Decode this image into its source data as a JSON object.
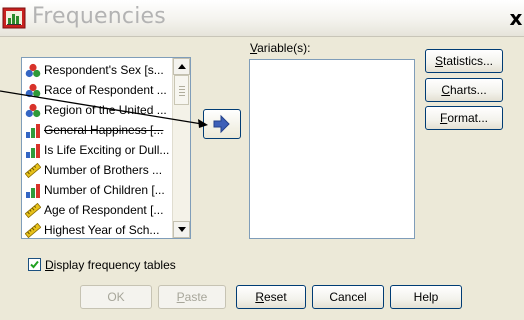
{
  "window": {
    "title": "Frequencies",
    "close_glyph": "x",
    "icon": "frequencies-app-icon"
  },
  "source_list": {
    "items": [
      {
        "label": "Respondent's Sex [s...",
        "icon": "nominal-icon"
      },
      {
        "label": "Race of Respondent ...",
        "icon": "nominal-icon"
      },
      {
        "label": "Region of the United ...",
        "icon": "nominal-icon"
      },
      {
        "label": "General Happiness [...",
        "icon": "ordinal-icon"
      },
      {
        "label": "Is Life Exciting or Dull...",
        "icon": "ordinal-icon"
      },
      {
        "label": "Number of Brothers ...",
        "icon": "scale-icon"
      },
      {
        "label": "Number of Children [...",
        "icon": "ordinal-icon"
      },
      {
        "label": "Age of Respondent [...",
        "icon": "scale-icon"
      },
      {
        "label": "Highest Year of Sch...",
        "icon": "scale-icon"
      }
    ]
  },
  "target": {
    "label_prefix": "",
    "label_mnemonic": "V",
    "label_rest": "ariable(s):"
  },
  "side_buttons": {
    "statistics": {
      "mnemonic": "S",
      "rest": "tatistics..."
    },
    "charts": {
      "mnemonic": "C",
      "rest": "harts..."
    },
    "format": {
      "mnemonic": "F",
      "rest": "ormat..."
    }
  },
  "display_tables": {
    "checked": true,
    "mnemonic": "D",
    "rest": "isplay frequency tables"
  },
  "bottom_buttons": {
    "ok": "OK",
    "paste": {
      "mnemonic": "P",
      "rest": "aste"
    },
    "reset": {
      "mnemonic": "R",
      "rest": "eset"
    },
    "cancel": "Cancel",
    "help": "Help"
  },
  "colors": {
    "dialog_bg": "#ece9d8",
    "title_text": "#b3b3b3",
    "move_arrow": "#3d5fb8",
    "nominal_red": "#d8332b",
    "nominal_green": "#2f9a3a",
    "nominal_blue": "#3466c4",
    "scale_yellow": "#e8c21a"
  }
}
